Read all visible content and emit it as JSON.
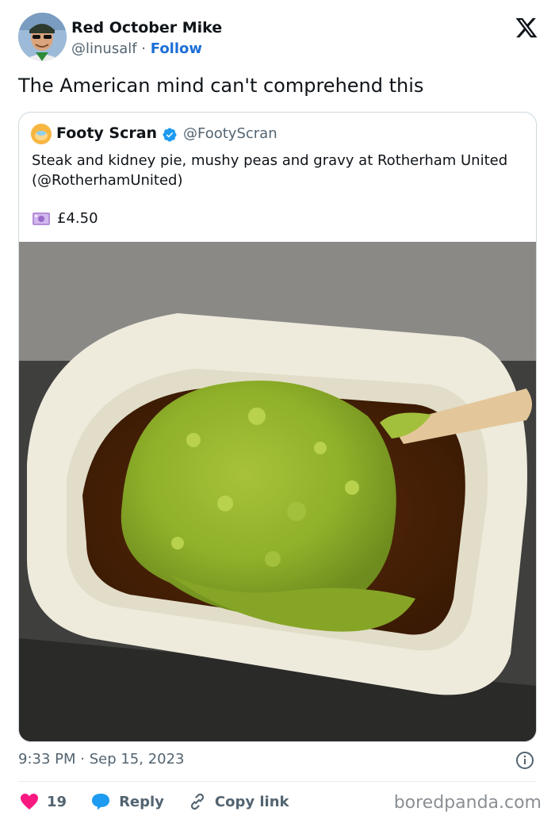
{
  "author": {
    "name": "Red October Mike",
    "handle": "@linusalf",
    "separator": " · ",
    "follow_label": "Follow"
  },
  "tweet": {
    "text": "The American mind can't comprehend this"
  },
  "quote": {
    "name": "Footy Scran",
    "handle": "@FootyScran",
    "text": "Steak and kidney pie, mushy peas and gravy at Rotherham United (@RotherhamUnited)",
    "price": "£4.50",
    "price_icon": "money-banknote-icon"
  },
  "meta": {
    "time": "9:33 PM",
    "separator": " · ",
    "date": "Sep 15, 2023"
  },
  "actions": {
    "like_count": "19",
    "reply_label": "Reply",
    "copy_link_label": "Copy link"
  },
  "watermark": "boredpanda.com",
  "colors": {
    "follow": "#1d6fd8",
    "like": "#f91880",
    "reply": "#1d9bf0",
    "verified": "#1d9bf0",
    "muted": "#536471"
  }
}
